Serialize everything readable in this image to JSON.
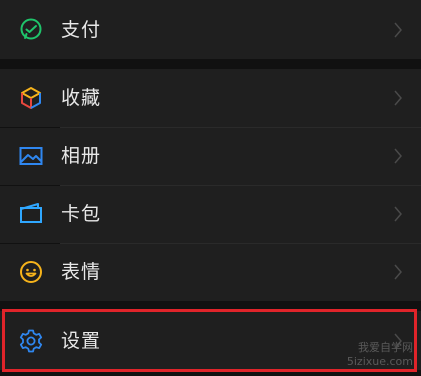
{
  "colors": {
    "background": "#111111",
    "row": "#1f1f1f",
    "text": "#e8e8e8",
    "chevron": "#4a4a4a",
    "highlight_border": "#e0242a",
    "pay_icon": "#1fc46b",
    "favorites_icon_a": "#f6b31b",
    "favorites_icon_b": "#e8483e",
    "favorites_icon_c": "#2f87f0",
    "album_icon": "#2f87f0",
    "cards_icon": "#2fa7ff",
    "stickers_icon": "#f6b31b",
    "settings_icon": "#2f87f0"
  },
  "menu": [
    {
      "label": "支付",
      "icon": "wechat-pay-icon"
    },
    {
      "label": "收藏",
      "icon": "favorites-cube-icon"
    },
    {
      "label": "相册",
      "icon": "album-image-icon"
    },
    {
      "label": "卡包",
      "icon": "card-wallet-icon"
    },
    {
      "label": "表情",
      "icon": "smiley-sticker-icon"
    },
    {
      "label": "设置",
      "icon": "settings-gear-icon"
    }
  ],
  "watermark": {
    "line1": "我爱自学网",
    "line2": "5izixue.com"
  }
}
